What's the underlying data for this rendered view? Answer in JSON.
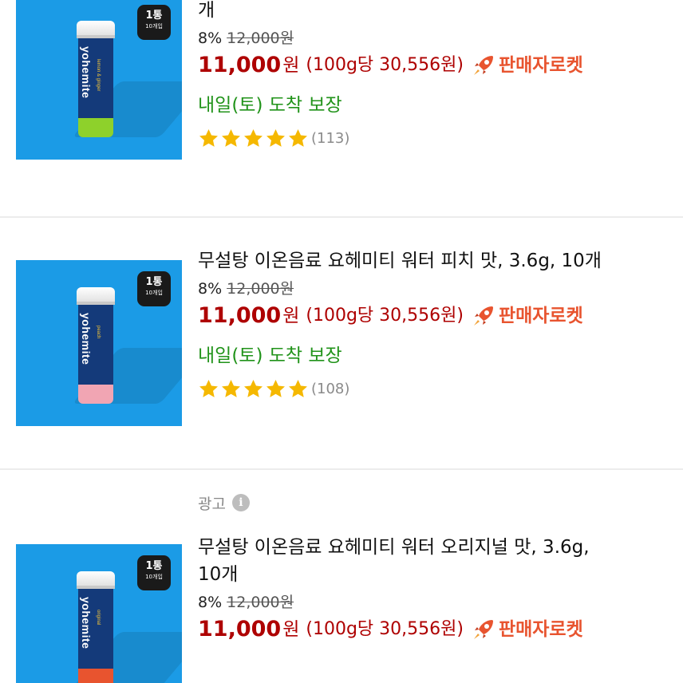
{
  "colors": {
    "sale_price": "#ae0000",
    "delivery": "#21931a",
    "rocket": "#e8542f",
    "star": "#f5b800",
    "thumb_bg": "#1b9be6",
    "tube_bottom_1": "#8ed12b",
    "tube_bottom_2": "#f1a5b3",
    "tube_bottom_3": "#e8542f"
  },
  "icons": [
    "rocket-icon",
    "star-icon",
    "info-icon"
  ],
  "products": [
    {
      "title": "개",
      "badge_main": "1통",
      "badge_sub": "10개입",
      "brand": "yohemite",
      "brand_sub": "lemon & ginger",
      "discount": "8%",
      "original_price": "12,000원",
      "sale_price": "11,000",
      "currency": "원",
      "unit_price": "(100g당 30,556원)",
      "rocket_label": "판매자로켓",
      "delivery": "내일(토) 도착 보장",
      "rating": 5,
      "review_count": "(113)"
    },
    {
      "title": "무설탕 이온음료 요헤미티 워터 피치 맛, 3.6g, 10개",
      "badge_main": "1통",
      "badge_sub": "10개입",
      "brand": "yohemite",
      "brand_sub": "peach",
      "discount": "8%",
      "original_price": "12,000원",
      "sale_price": "11,000",
      "currency": "원",
      "unit_price": "(100g당 30,556원)",
      "rocket_label": "판매자로켓",
      "delivery": "내일(토) 도착 보장",
      "rating": 5,
      "review_count": "(108)"
    },
    {
      "ad_label": "광고",
      "title_line1": "무설탕 이온음료 요헤미티 워터 오리지널 맛, 3.6g,",
      "title_line2": "10개",
      "badge_main": "1통",
      "badge_sub": "10개입",
      "brand": "yohemite",
      "brand_sub": "original",
      "discount": "8%",
      "original_price": "12,000원",
      "sale_price": "11,000",
      "currency": "원",
      "unit_price": "(100g당 30,556원)",
      "rocket_label": "판매자로켓"
    }
  ]
}
